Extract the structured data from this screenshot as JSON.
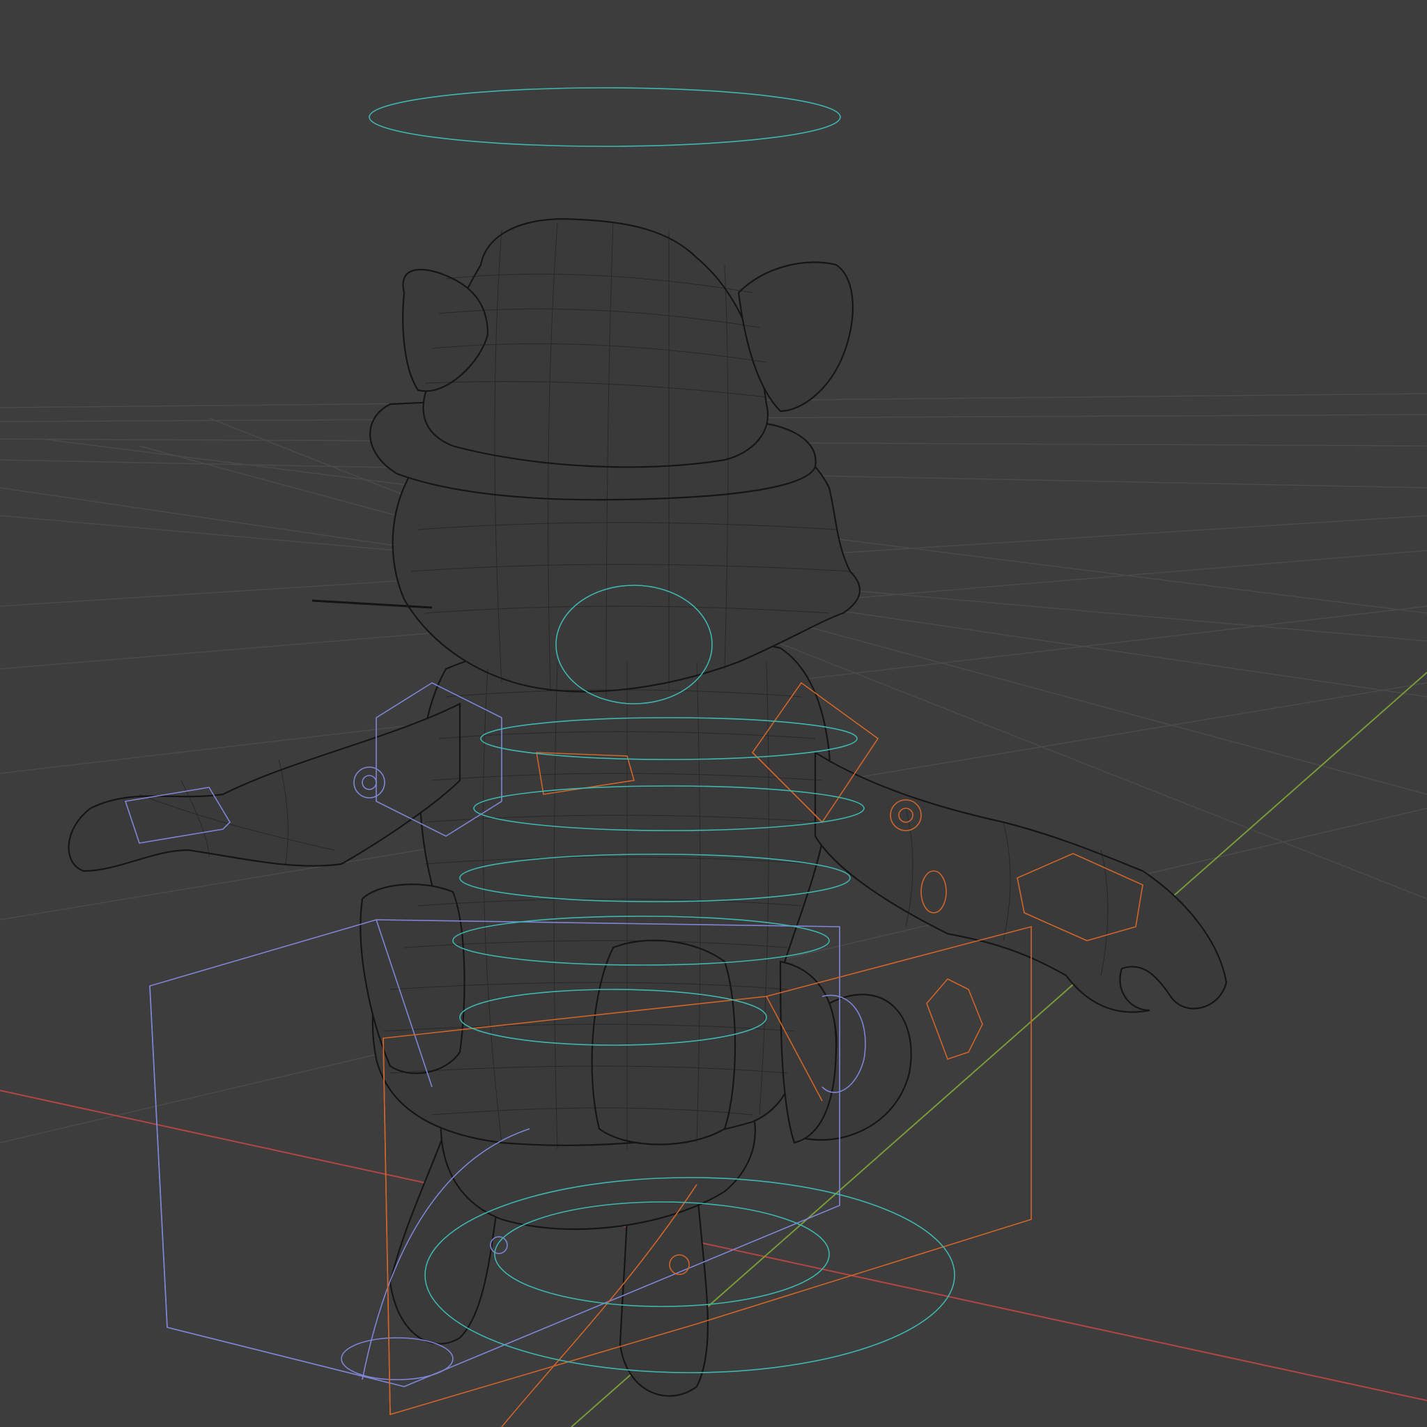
{
  "viewport": {
    "mode": "wireframe",
    "background_color": "#3d3d3d",
    "grid_color": "#4a4a4a",
    "axis_x_color": "#b34545",
    "axis_y_color": "#7a9a3a",
    "mesh_color": "#141414",
    "controls": {
      "left_color": "#7f86d6",
      "right_color": "#d0652a",
      "center_color": "#3fb7b0"
    }
  },
  "objects": {
    "character_mesh": "character-mesh",
    "halo_control": "root-halo-control",
    "armature_controls": "armature-controls"
  }
}
